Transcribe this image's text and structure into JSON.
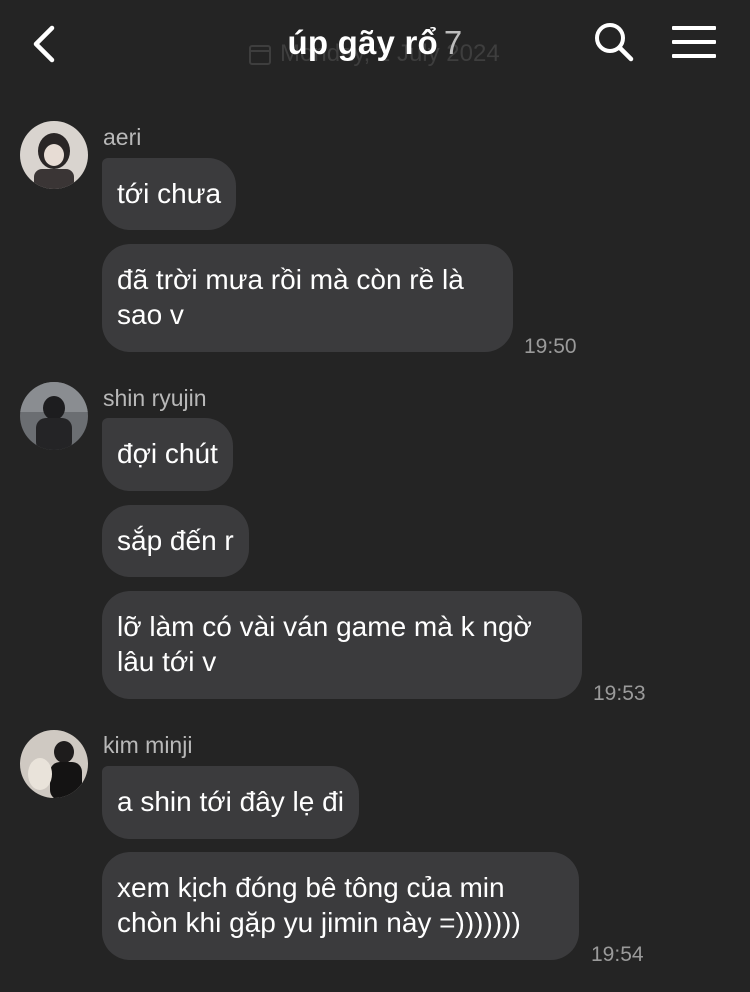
{
  "header": {
    "title": "úp gãy rổ",
    "member_count": "7",
    "date_overlay": "Monday, 1 July 2024"
  },
  "groups": [
    {
      "sender": "aeri",
      "messages": [
        "tới chưa",
        "đã trời mưa rồi mà còn rề là sao v"
      ],
      "time": "19:50"
    },
    {
      "sender": "shin ryujin",
      "messages": [
        "đợi chút",
        "sắp đến r",
        "lỡ làm có vài ván game mà k ngờ lâu tới v"
      ],
      "time": "19:53"
    },
    {
      "sender": "kim minji",
      "messages": [
        "a shin tới đây lẹ đi",
        "xem kịch đóng bê tông của min chòn khi gặp yu jimin này =)))))))"
      ],
      "time": "19:54"
    }
  ],
  "colors": {
    "background": "#242424",
    "bubble": "#3b3b3d",
    "sender_text": "#b8b8b8",
    "timestamp": "#9a9a9a"
  },
  "icons": [
    "back-arrow-icon",
    "search-icon",
    "menu-icon",
    "calendar-icon"
  ]
}
